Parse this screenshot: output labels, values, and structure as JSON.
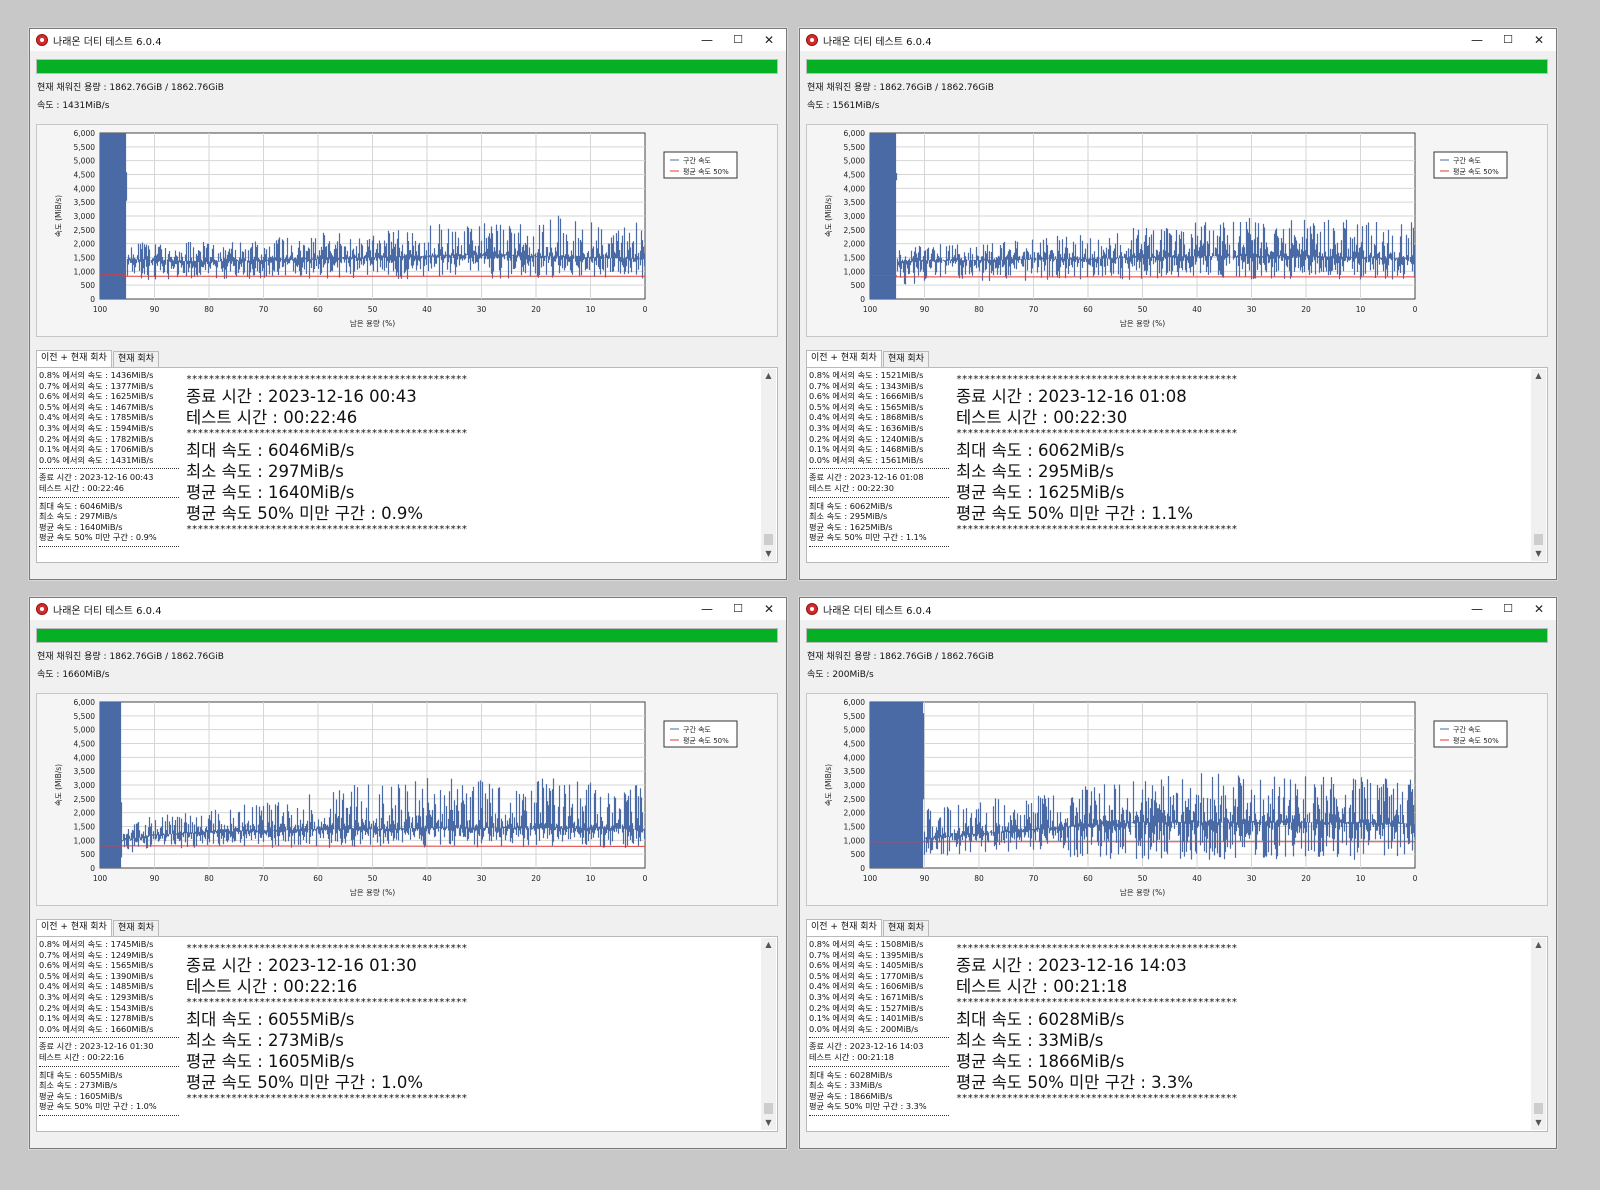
{
  "app": {
    "title": "나래온 더티 테스트 6.0.4",
    "minimize_glyph": "—",
    "maximize_glyph": "☐",
    "close_glyph": "✕",
    "icon": "app-logo-icon",
    "accent_progress": "#06b025",
    "series_color": "#4a6aa5",
    "avg_line_color": "#e03a3a"
  },
  "common": {
    "filled_label": "현재 채워진 용량 : 1862.76GiB / 1862.76GiB",
    "tab_all": "이전 + 현재 회차",
    "tab_current": "현재 회차",
    "stars": "**************************************************",
    "scroll_up": "▲",
    "scroll_down": "▼"
  },
  "windows": [
    {
      "speed_label": "속도 : 1431MiB/s",
      "left_rows": [
        "0.8% 에서의 속도 : 1436MiB/s",
        "0.7% 에서의 속도 : 1377MiB/s",
        "0.6% 에서의 속도 : 1625MiB/s",
        "0.5% 에서의 속도 : 1467MiB/s",
        "0.4% 에서의 속도 : 1785MiB/s",
        "0.3% 에서의 속도 : 1594MiB/s",
        "0.2% 에서의 속도 : 1782MiB/s",
        "0.1% 에서의 속도 : 1706MiB/s",
        "0.0% 에서의 속도 : 1431MiB/s"
      ],
      "left_end": "종료 시간 : 2023-12-16 00:43",
      "left_test": "테스트 시간 : 00:22:46",
      "left_max": "최대 속도 : 6046MiB/s",
      "left_min": "최소 속도 : 297MiB/s",
      "left_avg": "평균 속도 : 1640MiB/s",
      "left_below": "평균 속도 50% 미만 구간 : 0.9%",
      "big_end": "종료 시간 : 2023-12-16 00:43",
      "big_test": "테스트 시간 : 00:22:46",
      "big_max": "최대 속도 : 6046MiB/s",
      "big_min": "최소 속도 : 297MiB/s",
      "big_avg": "평균 속도 : 1640MiB/s",
      "big_below": "평균 속도 50% 미만 구간 : 0.9%"
    },
    {
      "speed_label": "속도 : 1561MiB/s",
      "left_rows": [
        "0.8% 에서의 속도 : 1521MiB/s",
        "0.7% 에서의 속도 : 1343MiB/s",
        "0.6% 에서의 속도 : 1666MiB/s",
        "0.5% 에서의 속도 : 1565MiB/s",
        "0.4% 에서의 속도 : 1868MiB/s",
        "0.3% 에서의 속도 : 1636MiB/s",
        "0.2% 에서의 속도 : 1240MiB/s",
        "0.1% 에서의 속도 : 1468MiB/s",
        "0.0% 에서의 속도 : 1561MiB/s"
      ],
      "left_end": "종료 시간 : 2023-12-16 01:08",
      "left_test": "테스트 시간 : 00:22:30",
      "left_max": "최대 속도 : 6062MiB/s",
      "left_min": "최소 속도 : 295MiB/s",
      "left_avg": "평균 속도 : 1625MiB/s",
      "left_below": "평균 속도 50% 미만 구간 : 1.1%",
      "big_end": "종료 시간 : 2023-12-16 01:08",
      "big_test": "테스트 시간 : 00:22:30",
      "big_max": "최대 속도 : 6062MiB/s",
      "big_min": "최소 속도 : 295MiB/s",
      "big_avg": "평균 속도 : 1625MiB/s",
      "big_below": "평균 속도 50% 미만 구간 : 1.1%"
    },
    {
      "speed_label": "속도 : 1660MiB/s",
      "left_rows": [
        "0.8% 에서의 속도 : 1745MiB/s",
        "0.7% 에서의 속도 : 1249MiB/s",
        "0.6% 에서의 속도 : 1565MiB/s",
        "0.5% 에서의 속도 : 1390MiB/s",
        "0.4% 에서의 속도 : 1485MiB/s",
        "0.3% 에서의 속도 : 1293MiB/s",
        "0.2% 에서의 속도 : 1543MiB/s",
        "0.1% 에서의 속도 : 1278MiB/s",
        "0.0% 에서의 속도 : 1660MiB/s"
      ],
      "left_end": "종료 시간 : 2023-12-16 01:30",
      "left_test": "테스트 시간 : 00:22:16",
      "left_max": "최대 속도 : 6055MiB/s",
      "left_min": "최소 속도 : 273MiB/s",
      "left_avg": "평균 속도 : 1605MiB/s",
      "left_below": "평균 속도 50% 미만 구간 : 1.0%",
      "big_end": "종료 시간 : 2023-12-16 01:30",
      "big_test": "테스트 시간 : 00:22:16",
      "big_max": "최대 속도 : 6055MiB/s",
      "big_min": "최소 속도 : 273MiB/s",
      "big_avg": "평균 속도 : 1605MiB/s",
      "big_below": "평균 속도 50% 미만 구간 : 1.0%"
    },
    {
      "speed_label": "속도 : 200MiB/s",
      "left_rows": [
        "0.8% 에서의 속도 : 1508MiB/s",
        "0.7% 에서의 속도 : 1395MiB/s",
        "0.6% 에서의 속도 : 1405MiB/s",
        "0.5% 에서의 속도 : 1770MiB/s",
        "0.4% 에서의 속도 : 1606MiB/s",
        "0.3% 에서의 속도 : 1671MiB/s",
        "0.2% 에서의 속도 : 1527MiB/s",
        "0.1% 에서의 속도 : 1401MiB/s",
        "0.0% 에서의 속도 : 200MiB/s"
      ],
      "left_end": "종료 시간 : 2023-12-16 14:03",
      "left_test": "테스트 시간 : 00:21:18",
      "left_max": "최대 속도 : 6028MiB/s",
      "left_min": "최소 속도 : 33MiB/s",
      "left_avg": "평균 속도 : 1866MiB/s",
      "left_below": "평균 속도 50% 미만 구간 : 3.3%",
      "big_end": "종료 시간 : 2023-12-16 14:03",
      "big_test": "테스트 시간 : 00:21:18",
      "big_max": "최대 속도 : 6028MiB/s",
      "big_min": "최소 속도 : 33MiB/s",
      "big_avg": "평균 속도 : 1866MiB/s",
      "big_below": "평균 속도 50% 미만 구간 : 3.3%"
    }
  ],
  "chart_data": [
    {
      "type": "area",
      "ylabel": "속도 (MiB/s)",
      "xlabel": "남은 용량 (%)",
      "x_ticks": [
        100,
        90,
        80,
        70,
        60,
        50,
        40,
        30,
        20,
        10,
        0
      ],
      "y_ticks": [
        0,
        500,
        "1,000",
        "1,500",
        "2,000",
        "2,500",
        "3,000",
        "3,500",
        "4,000",
        "4,500",
        "5,000",
        "5,500",
        "6,000"
      ],
      "xlim": [
        100,
        0
      ],
      "ylim": [
        0,
        6000
      ],
      "grid": true,
      "legend": "top-right",
      "series": [
        {
          "name": "구간 속도",
          "x": [
            100,
            95.2,
            95,
            90,
            80,
            70,
            60,
            50,
            40,
            30,
            20,
            10,
            0
          ],
          "y": [
            6000,
            6000,
            1450,
            1400,
            1350,
            1400,
            1450,
            1500,
            1550,
            1600,
            1550,
            1500,
            1450
          ],
          "y_min": [
            0,
            0,
            650,
            700,
            700,
            720,
            720,
            700,
            720,
            720,
            720,
            720,
            720
          ],
          "y_max": [
            6000,
            6000,
            2100,
            2000,
            2100,
            2200,
            2400,
            2500,
            2700,
            2800,
            3100,
            2900,
            2800
          ]
        },
        {
          "name": "평균 속도 50%",
          "x": [
            100,
            95.5,
            95.5,
            0
          ],
          "y": [
            870,
            870,
            820,
            820
          ]
        }
      ]
    },
    {
      "type": "area",
      "ylabel": "속도 (MiB/s)",
      "xlabel": "남은 용량 (%)",
      "x_ticks": [
        100,
        90,
        80,
        70,
        60,
        50,
        40,
        30,
        20,
        10,
        0
      ],
      "y_ticks": [
        0,
        500,
        "1,000",
        "1,500",
        "2,000",
        "2,500",
        "3,000",
        "3,500",
        "4,000",
        "4,500",
        "5,000",
        "5,500",
        "6,000"
      ],
      "xlim": [
        100,
        0
      ],
      "ylim": [
        0,
        6000
      ],
      "grid": true,
      "legend": "top-right",
      "series": [
        {
          "name": "구간 속도",
          "x": [
            100,
            95.2,
            95,
            90,
            80,
            70,
            60,
            50,
            40,
            30,
            20,
            10,
            0
          ],
          "y": [
            6000,
            6000,
            1350,
            1400,
            1400,
            1450,
            1450,
            1500,
            1550,
            1550,
            1550,
            1500,
            1450
          ],
          "y_min": [
            0,
            0,
            300,
            650,
            650,
            650,
            680,
            680,
            700,
            700,
            700,
            700,
            700
          ],
          "y_max": [
            6000,
            6000,
            1800,
            2000,
            2000,
            2200,
            2400,
            2600,
            2800,
            3000,
            2900,
            2900,
            2800
          ]
        },
        {
          "name": "평균 속도 50%",
          "x": [
            100,
            95.2,
            95.2,
            0
          ],
          "y": [
            850,
            850,
            800,
            800
          ]
        }
      ]
    },
    {
      "type": "area",
      "ylabel": "속도 (MiB/s)",
      "xlabel": "남은 용량 (%)",
      "x_ticks": [
        100,
        90,
        80,
        70,
        60,
        50,
        40,
        30,
        20,
        10,
        0
      ],
      "y_ticks": [
        0,
        500,
        "1,000",
        "1,500",
        "2,000",
        "2,500",
        "3,000",
        "3,500",
        "4,000",
        "4,500",
        "5,000",
        "5,500",
        "6,000"
      ],
      "xlim": [
        100,
        0
      ],
      "ylim": [
        0,
        6000
      ],
      "grid": true,
      "legend": "top-right",
      "series": [
        {
          "name": "구간 속도",
          "x": [
            100,
            96.2,
            96,
            90,
            80,
            70,
            60,
            50,
            40,
            30,
            20,
            10,
            0
          ],
          "y": [
            6000,
            6000,
            1000,
            1200,
            1300,
            1350,
            1400,
            1400,
            1450,
            1450,
            1450,
            1450,
            1400
          ],
          "y_min": [
            0,
            0,
            350,
            700,
            720,
            720,
            720,
            720,
            720,
            720,
            720,
            720,
            720
          ],
          "y_max": [
            6000,
            6000,
            1600,
            1900,
            2200,
            2500,
            2800,
            3100,
            3300,
            3200,
            3300,
            3100,
            3000
          ]
        },
        {
          "name": "평균 속도 50%",
          "x": [
            100,
            96,
            96,
            0
          ],
          "y": [
            800,
            800,
            800,
            780
          ]
        }
      ]
    },
    {
      "type": "area",
      "ylabel": "속도 (MiB/s)",
      "xlabel": "남은 용량 (%)",
      "x_ticks": [
        100,
        90,
        80,
        70,
        60,
        50,
        40,
        30,
        20,
        10,
        0
      ],
      "y_ticks": [
        0,
        500,
        "1,000",
        "1,500",
        "2,000",
        "2,500",
        "3,000",
        "3,500",
        "4,000",
        "4,500",
        "5,000",
        "5,500",
        "6,000"
      ],
      "xlim": [
        100,
        0
      ],
      "ylim": [
        0,
        6000
      ],
      "grid": true,
      "legend": "top-right",
      "series": [
        {
          "name": "구간 속도",
          "x": [
            100,
            90.2,
            90,
            80,
            70,
            60,
            50,
            40,
            30,
            20,
            10,
            0
          ],
          "y": [
            6000,
            6000,
            1050,
            1250,
            1400,
            1550,
            1650,
            1650,
            1650,
            1650,
            1650,
            1600
          ],
          "y_min": [
            0,
            0,
            350,
            550,
            600,
            300,
            300,
            300,
            300,
            300,
            300,
            300
          ],
          "y_max": [
            6000,
            6000,
            2200,
            2400,
            2800,
            3000,
            3200,
            3500,
            3300,
            3400,
            3300,
            3200
          ]
        },
        {
          "name": "평균 속도 50%",
          "x": [
            100,
            90,
            90,
            0
          ],
          "y": [
            950,
            950,
            950,
            950
          ]
        }
      ]
    }
  ]
}
